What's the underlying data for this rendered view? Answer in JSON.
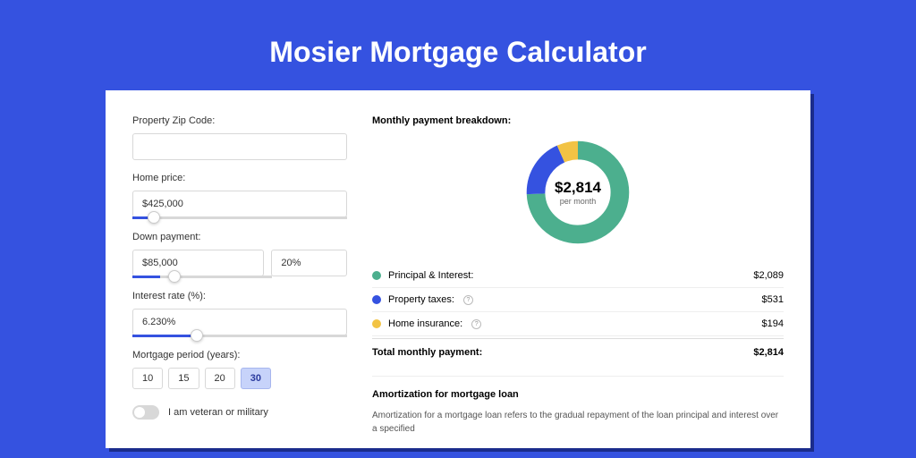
{
  "title": "Mosier Mortgage Calculator",
  "form": {
    "zip_label": "Property Zip Code:",
    "zip_value": "",
    "home_price_label": "Home price:",
    "home_price_value": "$425,000",
    "down_payment_label": "Down payment:",
    "down_payment_value": "$85,000",
    "down_payment_pct": "20%",
    "interest_label": "Interest rate (%):",
    "interest_value": "6.230%",
    "period_label": "Mortgage period (years):",
    "periods": [
      "10",
      "15",
      "20",
      "30"
    ],
    "period_selected": "30",
    "veteran_label": "I am veteran or military"
  },
  "breakdown": {
    "title": "Monthly payment breakdown:",
    "center_amount": "$2,814",
    "center_sub": "per month",
    "items": [
      {
        "label": "Principal & Interest:",
        "value": "$2,089",
        "color": "green",
        "info": false
      },
      {
        "label": "Property taxes:",
        "value": "$531",
        "color": "blue",
        "info": true
      },
      {
        "label": "Home insurance:",
        "value": "$194",
        "color": "yellow",
        "info": true
      }
    ],
    "total_label": "Total monthly payment:",
    "total_value": "$2,814"
  },
  "amort": {
    "title": "Amortization for mortgage loan",
    "text": "Amortization for a mortgage loan refers to the gradual repayment of the loan principal and interest over a specified"
  },
  "chart_data": {
    "type": "pie",
    "title": "Monthly payment breakdown",
    "series": [
      {
        "name": "Principal & Interest",
        "value": 2089,
        "color": "#4caf8e"
      },
      {
        "name": "Property taxes",
        "value": 531,
        "color": "#3552e0"
      },
      {
        "name": "Home insurance",
        "value": 194,
        "color": "#f2c344"
      }
    ],
    "total": 2814,
    "unit": "USD/month"
  }
}
